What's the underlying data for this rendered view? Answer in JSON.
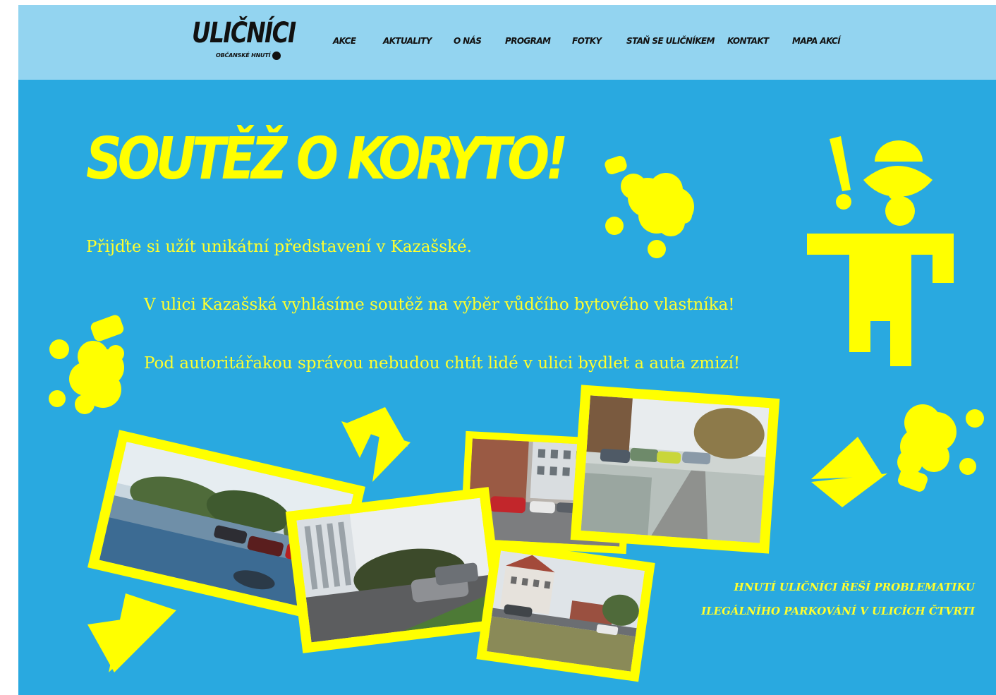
{
  "brand": {
    "name": "ULIČNÍCI",
    "subtitle": "OBČANSKÉ HNUTÍ"
  },
  "nav": {
    "items": [
      {
        "label": "AKCE"
      },
      {
        "label": "AKTUALITY"
      },
      {
        "label": "O NÁS"
      },
      {
        "label": "PROGRAM"
      },
      {
        "label": "FOTKY"
      },
      {
        "label": "STAŇ SE ULIČNÍKEM"
      },
      {
        "label": "KONTAKT"
      },
      {
        "label": "MAPA AKCÍ"
      }
    ]
  },
  "hero": {
    "title": "SOUTĚŽ O KORYTO!",
    "paragraphs": [
      "Přijďte si užít unikátní představení v Kazašské.",
      "V ulici Kazašská vyhlásíme soutěž na výběr vůdčího bytového vlastníka!",
      "Pod autoritářakou správou nebudou chtít lidé v ulici bydlet a auta zmizí!"
    ],
    "tagline": [
      "HNUTÍ ULIČNÍCI ŘEŠÍ PROBLEMATIKU",
      "ILEGÁLNÍHO PARKOVÁNÍ V ULICÍCH ČTVRTI"
    ]
  },
  "colors": {
    "topbar": "#93d4f0",
    "background": "#29a9e0",
    "accent_yellow": "#ffff00",
    "text_dark": "#111111"
  },
  "icons": [
    "logo-dot",
    "cloud-decoration",
    "arrow-decoration",
    "stick-figure-illustration",
    "exclamation-mark"
  ]
}
